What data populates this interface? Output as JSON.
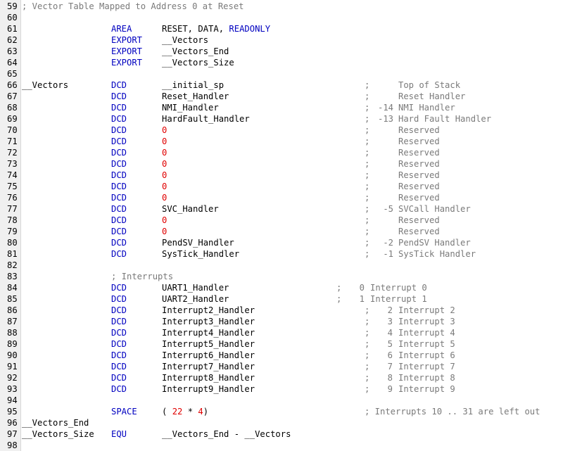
{
  "editor": {
    "line_numbers": [
      "59",
      "60",
      "61",
      "62",
      "63",
      "64",
      "65",
      "66",
      "67",
      "68",
      "69",
      "70",
      "71",
      "72",
      "73",
      "74",
      "75",
      "76",
      "77",
      "78",
      "79",
      "80",
      "81",
      "82",
      "83",
      "84",
      "85",
      "86",
      "87",
      "88",
      "89",
      "90",
      "91",
      "92",
      "93",
      "94",
      "95",
      "96",
      "97",
      "98"
    ],
    "l59_comment": "; Vector Table Mapped to Address 0 at Reset",
    "area": {
      "op": "AREA",
      "args": "RESET, DATA, ",
      "readonly": "READONLY"
    },
    "exports": [
      {
        "op": "EXPORT",
        "arg": "__Vectors"
      },
      {
        "op": "EXPORT",
        "arg": "__Vectors_End"
      },
      {
        "op": "EXPORT",
        "arg": "__Vectors_Size"
      }
    ],
    "vectors_label": "__Vectors",
    "vector_entries": [
      {
        "op": "DCD",
        "arg": "__initial_sp",
        "num": "",
        "desc": "Top of Stack"
      },
      {
        "op": "DCD",
        "arg": "Reset_Handler",
        "num": "",
        "desc": "Reset Handler"
      },
      {
        "op": "DCD",
        "arg": "NMI_Handler",
        "num": "-14",
        "desc": "NMI Handler"
      },
      {
        "op": "DCD",
        "arg": "HardFault_Handler",
        "num": "-13",
        "desc": "Hard Fault Handler"
      },
      {
        "op": "DCD",
        "arg": "0",
        "num": "",
        "desc": "Reserved"
      },
      {
        "op": "DCD",
        "arg": "0",
        "num": "",
        "desc": "Reserved"
      },
      {
        "op": "DCD",
        "arg": "0",
        "num": "",
        "desc": "Reserved"
      },
      {
        "op": "DCD",
        "arg": "0",
        "num": "",
        "desc": "Reserved"
      },
      {
        "op": "DCD",
        "arg": "0",
        "num": "",
        "desc": "Reserved"
      },
      {
        "op": "DCD",
        "arg": "0",
        "num": "",
        "desc": "Reserved"
      },
      {
        "op": "DCD",
        "arg": "0",
        "num": "",
        "desc": "Reserved"
      },
      {
        "op": "DCD",
        "arg": "SVC_Handler",
        "num": "-5",
        "desc": "SVCall Handler"
      },
      {
        "op": "DCD",
        "arg": "0",
        "num": "",
        "desc": "Reserved"
      },
      {
        "op": "DCD",
        "arg": "0",
        "num": "",
        "desc": "Reserved"
      },
      {
        "op": "DCD",
        "arg": "PendSV_Handler",
        "num": "-2",
        "desc": "PendSV Handler"
      },
      {
        "op": "DCD",
        "arg": "SysTick_Handler",
        "num": "-1",
        "desc": "SysTick Handler"
      }
    ],
    "interrupts_comment": "; Interrupts",
    "irq_entries": [
      {
        "op": "DCD",
        "arg": "UART1_Handler",
        "num": "0",
        "desc": "Interrupt 0"
      },
      {
        "op": "DCD",
        "arg": "UART2_Handler",
        "num": "1",
        "desc": "Interrupt 1"
      },
      {
        "op": "DCD",
        "arg": "Interrupt2_Handler",
        "num": "2",
        "desc": "Interrupt 2"
      },
      {
        "op": "DCD",
        "arg": "Interrupt3_Handler",
        "num": "3",
        "desc": "Interrupt 3"
      },
      {
        "op": "DCD",
        "arg": "Interrupt4_Handler",
        "num": "4",
        "desc": "Interrupt 4"
      },
      {
        "op": "DCD",
        "arg": "Interrupt5_Handler",
        "num": "5",
        "desc": "Interrupt 5"
      },
      {
        "op": "DCD",
        "arg": "Interrupt6_Handler",
        "num": "6",
        "desc": "Interrupt 6"
      },
      {
        "op": "DCD",
        "arg": "Interrupt7_Handler",
        "num": "7",
        "desc": "Interrupt 7"
      },
      {
        "op": "DCD",
        "arg": "Interrupt8_Handler",
        "num": "8",
        "desc": "Interrupt 8"
      },
      {
        "op": "DCD",
        "arg": "Interrupt9_Handler",
        "num": "9",
        "desc": "Interrupt 9"
      }
    ],
    "space": {
      "op": "SPACE",
      "open": "( ",
      "a": "22",
      "mul": " * ",
      "b": "4",
      "close": ")",
      "comment": "; Interrupts 10 .. 31 are left out"
    },
    "vectors_end_label": "__Vectors_End",
    "vectors_size": {
      "label": "__Vectors_Size",
      "op": "EQU",
      "arg": "__Vectors_End - __Vectors"
    },
    "colors": {
      "keyword": "#0000c0",
      "number": "#e00000",
      "comment": "#7a7a7a",
      "gutter": "#f0f0f0"
    }
  }
}
